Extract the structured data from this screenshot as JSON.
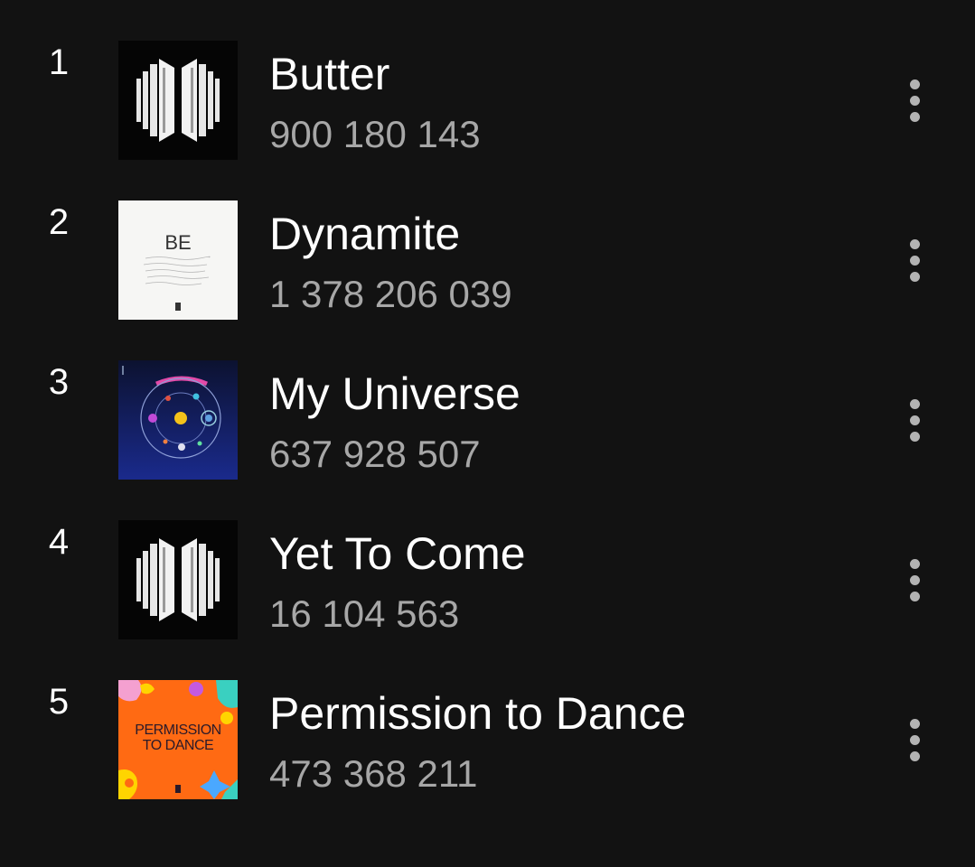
{
  "tracks": [
    {
      "rank": "1",
      "title": "Butter",
      "plays": "900 180 143",
      "art": "proof-art"
    },
    {
      "rank": "2",
      "title": "Dynamite",
      "plays": "1 378 206 039",
      "art": "be-art"
    },
    {
      "rank": "3",
      "title": "My Universe",
      "plays": "637 928 507",
      "art": "music-of-the-spheres-art"
    },
    {
      "rank": "4",
      "title": "Yet To Come",
      "plays": "16 104 563",
      "art": "proof-art"
    },
    {
      "rank": "5",
      "title": "Permission to Dance",
      "plays": "473 368 211",
      "art": "permission-to-dance-art"
    }
  ],
  "art_text": {
    "be": "BE",
    "permission_line1": "PERMISSION",
    "permission_line2": "TO DANCE"
  },
  "colors": {
    "background": "#121212",
    "primary_text": "#ffffff",
    "secondary_text": "#a7a7a7",
    "permission_orange": "#ff6a13"
  }
}
